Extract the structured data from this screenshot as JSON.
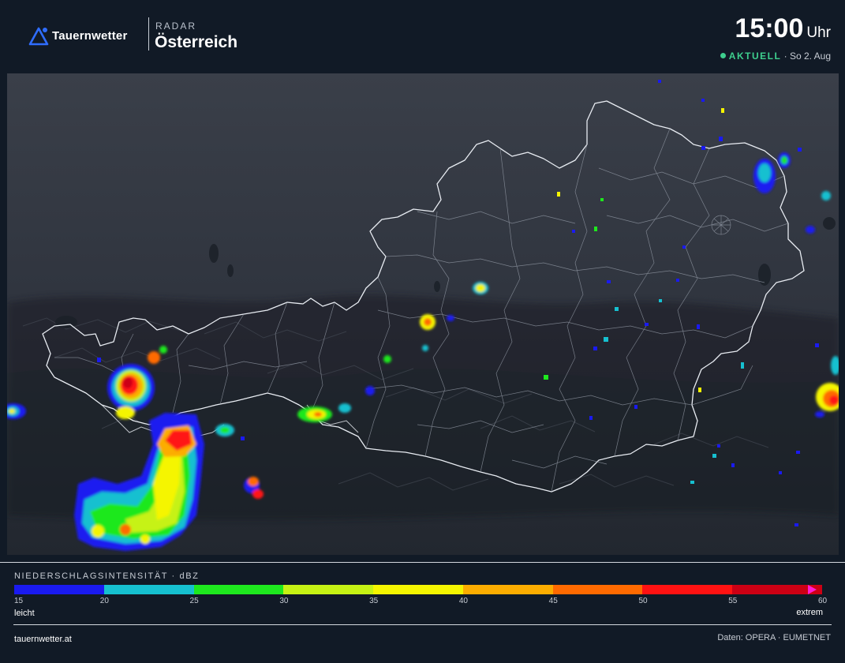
{
  "header": {
    "brand": "Tauernwetter",
    "kicker": "RADAR",
    "region": "Österreich",
    "time": "15:00",
    "time_unit": "Uhr",
    "status_live": "AKTUELL",
    "status_date": "· So 2. Aug"
  },
  "map": {
    "description_icon": "radar-map",
    "colors": {
      "background": "#2c323d",
      "border": "#e8ecf2"
    }
  },
  "legend": {
    "title": "NIEDERSCHLAGSINTENSITÄT · dBZ",
    "ticks": [
      "15",
      "20",
      "25",
      "30",
      "35",
      "40",
      "45",
      "50",
      "55",
      "60"
    ],
    "colors": [
      "#1a1af0",
      "#16c0d0",
      "#1ee81e",
      "#c6f214",
      "#f5f500",
      "#fcad00",
      "#ff6a00",
      "#ff1212",
      "#cc0014"
    ],
    "arrow_color": "#ff1fd2",
    "low_label": "leicht",
    "high_label": "extrem"
  },
  "footer": {
    "site": "tauernwetter.at",
    "credit": "Daten: OPERA · EUMETNET"
  },
  "colors": {
    "page_background": "#111a26",
    "live_accent": "#3ecf8e"
  }
}
